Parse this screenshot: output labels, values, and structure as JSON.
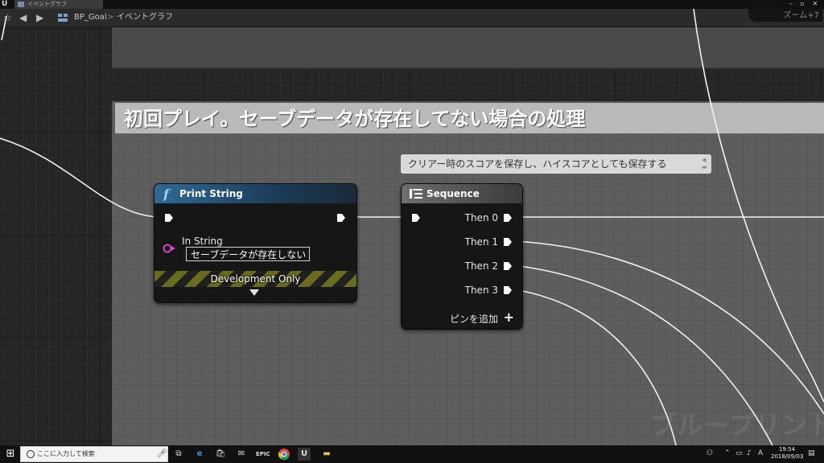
{
  "window": {
    "tab_title": "イベントグラフ"
  },
  "toolbar": {
    "breadcrumb_blueprint": "BP_Goal",
    "breadcrumb_separator": ">",
    "breadcrumb_graph": "イベントグラフ",
    "zoom_label": "ズーム+7"
  },
  "comment": {
    "title": "初回プレイ。セーブデータが存在してない場合の処理"
  },
  "tooltip": {
    "text": "クリアー時のスコアを保存し、ハイスコアとしても保存する"
  },
  "print_node": {
    "title": "Print String",
    "fn_icon": "f",
    "in_string_label": "In String",
    "in_string_value": "セーブデータが存在しない",
    "dev_only_label": "Development Only"
  },
  "sequence_node": {
    "title": "Sequence",
    "outputs": [
      "Then 0",
      "Then 1",
      "Then 2",
      "Then 3"
    ],
    "add_pin_label": "ピンを追加"
  },
  "watermark": "ブループリント",
  "taskbar": {
    "search_placeholder": "ここに入力して検索",
    "time": "19:54",
    "date": "2018/09/03"
  },
  "colors": {
    "exec_pin": "#ffffff",
    "string_pin": "#e040c8",
    "function_header": "#2e6a95",
    "comment_header": "#b9b9b9"
  }
}
